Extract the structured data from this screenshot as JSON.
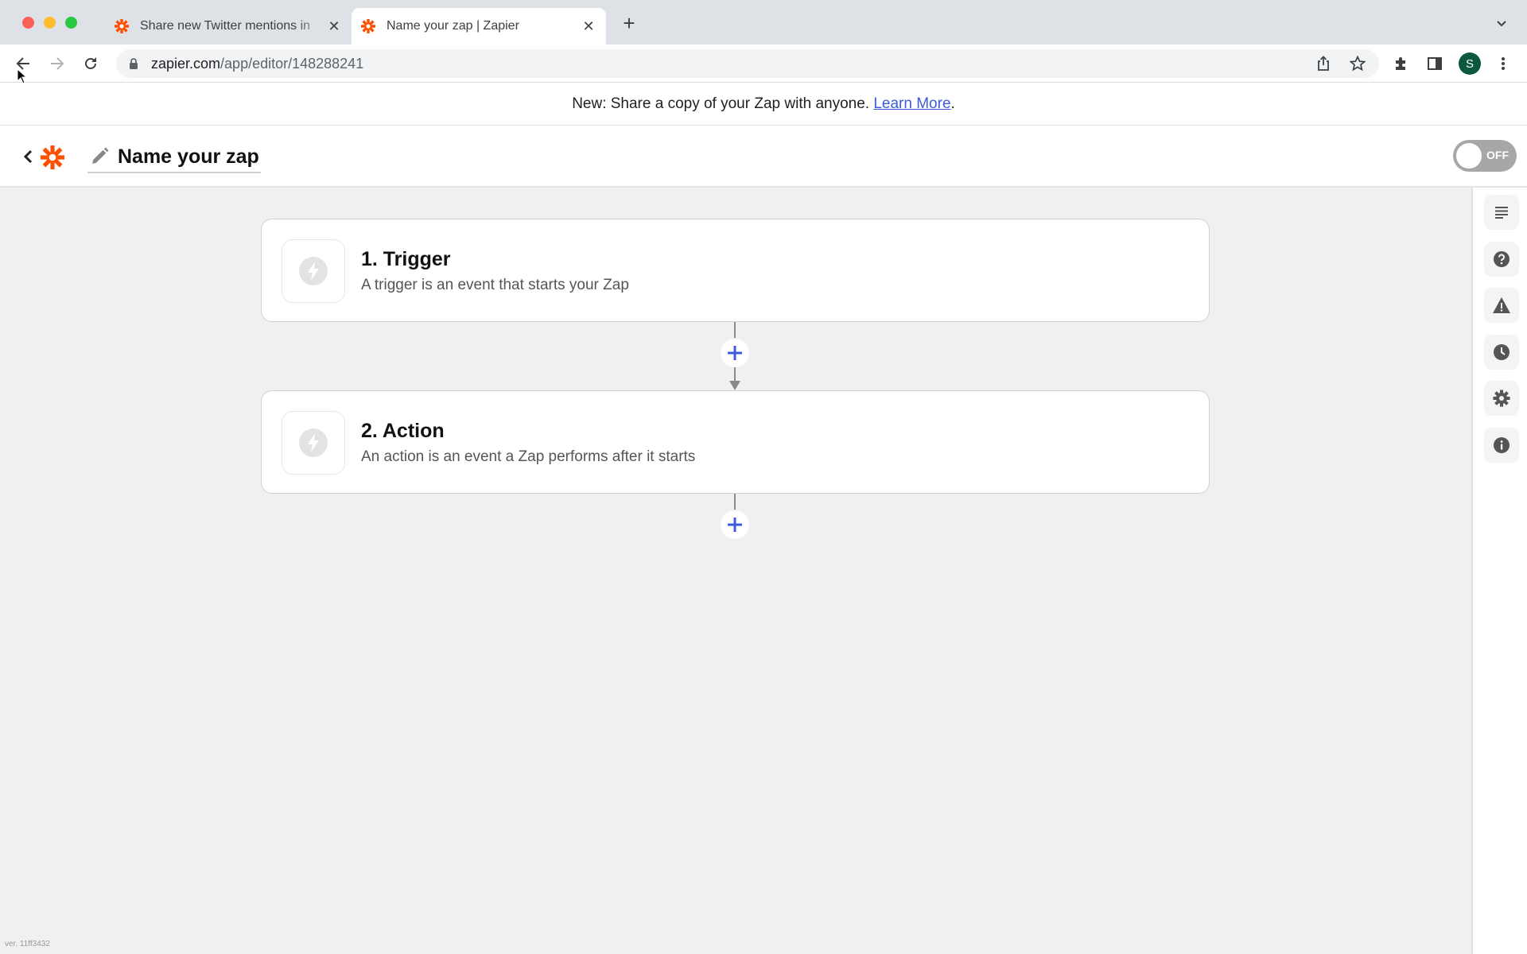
{
  "browser": {
    "tabs": [
      {
        "title": "Share new Twitter mentions in",
        "active": false,
        "favicon": "zapier-icon"
      },
      {
        "title": "Name your zap | Zapier",
        "active": true,
        "favicon": "zapier-icon"
      }
    ],
    "new_tab_label": "+",
    "address": {
      "host": "zapier.com",
      "path": "/app/editor/148288241"
    },
    "profile_initial": "S"
  },
  "banner": {
    "text": "New: Share a copy of your Zap with anyone. ",
    "link": "Learn More",
    "suffix": "."
  },
  "editor": {
    "zap_name": "Name your zap",
    "toggle_label": "OFF",
    "toggle_on": false
  },
  "steps": [
    {
      "title": "1. Trigger",
      "description": "A trigger is an event that starts your Zap"
    },
    {
      "title": "2. Action",
      "description": "An action is an event a Zap performs after it starts"
    }
  ],
  "sidebar": {
    "items": [
      {
        "icon": "outline-icon"
      },
      {
        "icon": "help-icon"
      },
      {
        "icon": "warning-icon"
      },
      {
        "icon": "history-icon"
      },
      {
        "icon": "settings-icon"
      },
      {
        "icon": "info-icon"
      }
    ]
  },
  "footer": {
    "version": "ver. 11ff3432"
  },
  "colors": {
    "brand": "#ff4f00",
    "link": "#3b5bdb",
    "plus": "#3b5bdb",
    "toggle_off": "#a7a7a7"
  }
}
